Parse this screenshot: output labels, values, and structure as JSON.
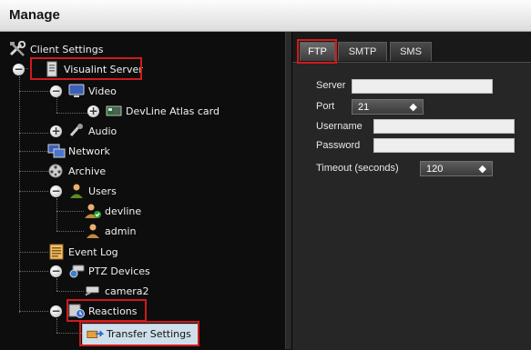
{
  "window": {
    "title": "Manage"
  },
  "tree": {
    "client_settings": "Client Settings",
    "server": "Visualint Server",
    "video": "Video",
    "card": "DevLine Atlas card",
    "audio": "Audio",
    "network": "Network",
    "archive": "Archive",
    "users": "Users",
    "user1": "devline",
    "user2": "admin",
    "event_log": "Event Log",
    "ptz": "PTZ Devices",
    "camera": "camera2",
    "reactions": "Reactions",
    "transfer": "Transfer Settings",
    "toggle_expanded": "−",
    "toggle_collapsed": "+"
  },
  "tabs": {
    "ftp": "FTP",
    "smtp": "SMTP",
    "sms": "SMS"
  },
  "ftp_form": {
    "server_label": "Server",
    "server_value": "",
    "port_label": "Port",
    "port_value": "21",
    "username_label": "Username",
    "username_value": "",
    "password_label": "Password",
    "password_value": "",
    "timeout_label": "Timeout (seconds)",
    "timeout_value": "120"
  },
  "colors": {
    "highlight": "#d11a1a",
    "selection": "#cfe0ec"
  }
}
